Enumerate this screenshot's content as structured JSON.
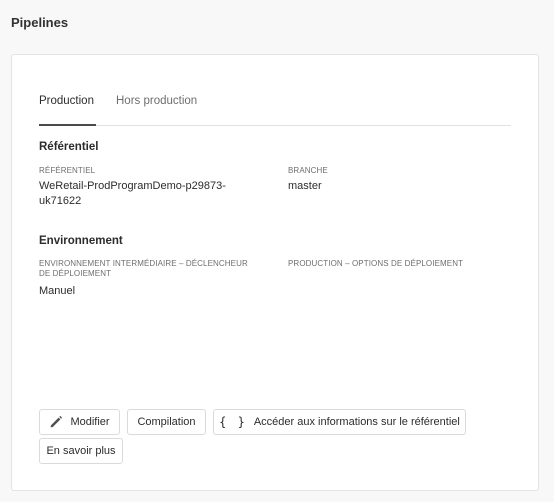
{
  "page": {
    "title": "Pipelines"
  },
  "tabs": [
    {
      "label": "Production",
      "active": true
    },
    {
      "label": "Hors production",
      "active": false
    }
  ],
  "referentiel": {
    "heading": "Référentiel",
    "repo_label": "Référentiel",
    "repo_value_line1": "WeRetail-ProdProgramDemo-p29873-",
    "repo_value_line2": "uk71622",
    "branch_label": "Branche",
    "branch_value": "master"
  },
  "environnement": {
    "heading": "Environnement",
    "stage_label_line1": "Environnement intermédiaire – Déclencheur",
    "stage_label_line2": "de déploiement",
    "stage_value": "Manuel",
    "prod_label": "Production – Options de déploiement"
  },
  "actions": {
    "modifier": "Modifier",
    "compilation": "Compilation",
    "braces_icon": "{ }",
    "repo_info": "Accéder aux informations sur le référentiel",
    "en_savoir_plus": "En savoir plus"
  },
  "colors": {
    "tab_underline": "#4b4b4b",
    "border": "#dadada"
  }
}
